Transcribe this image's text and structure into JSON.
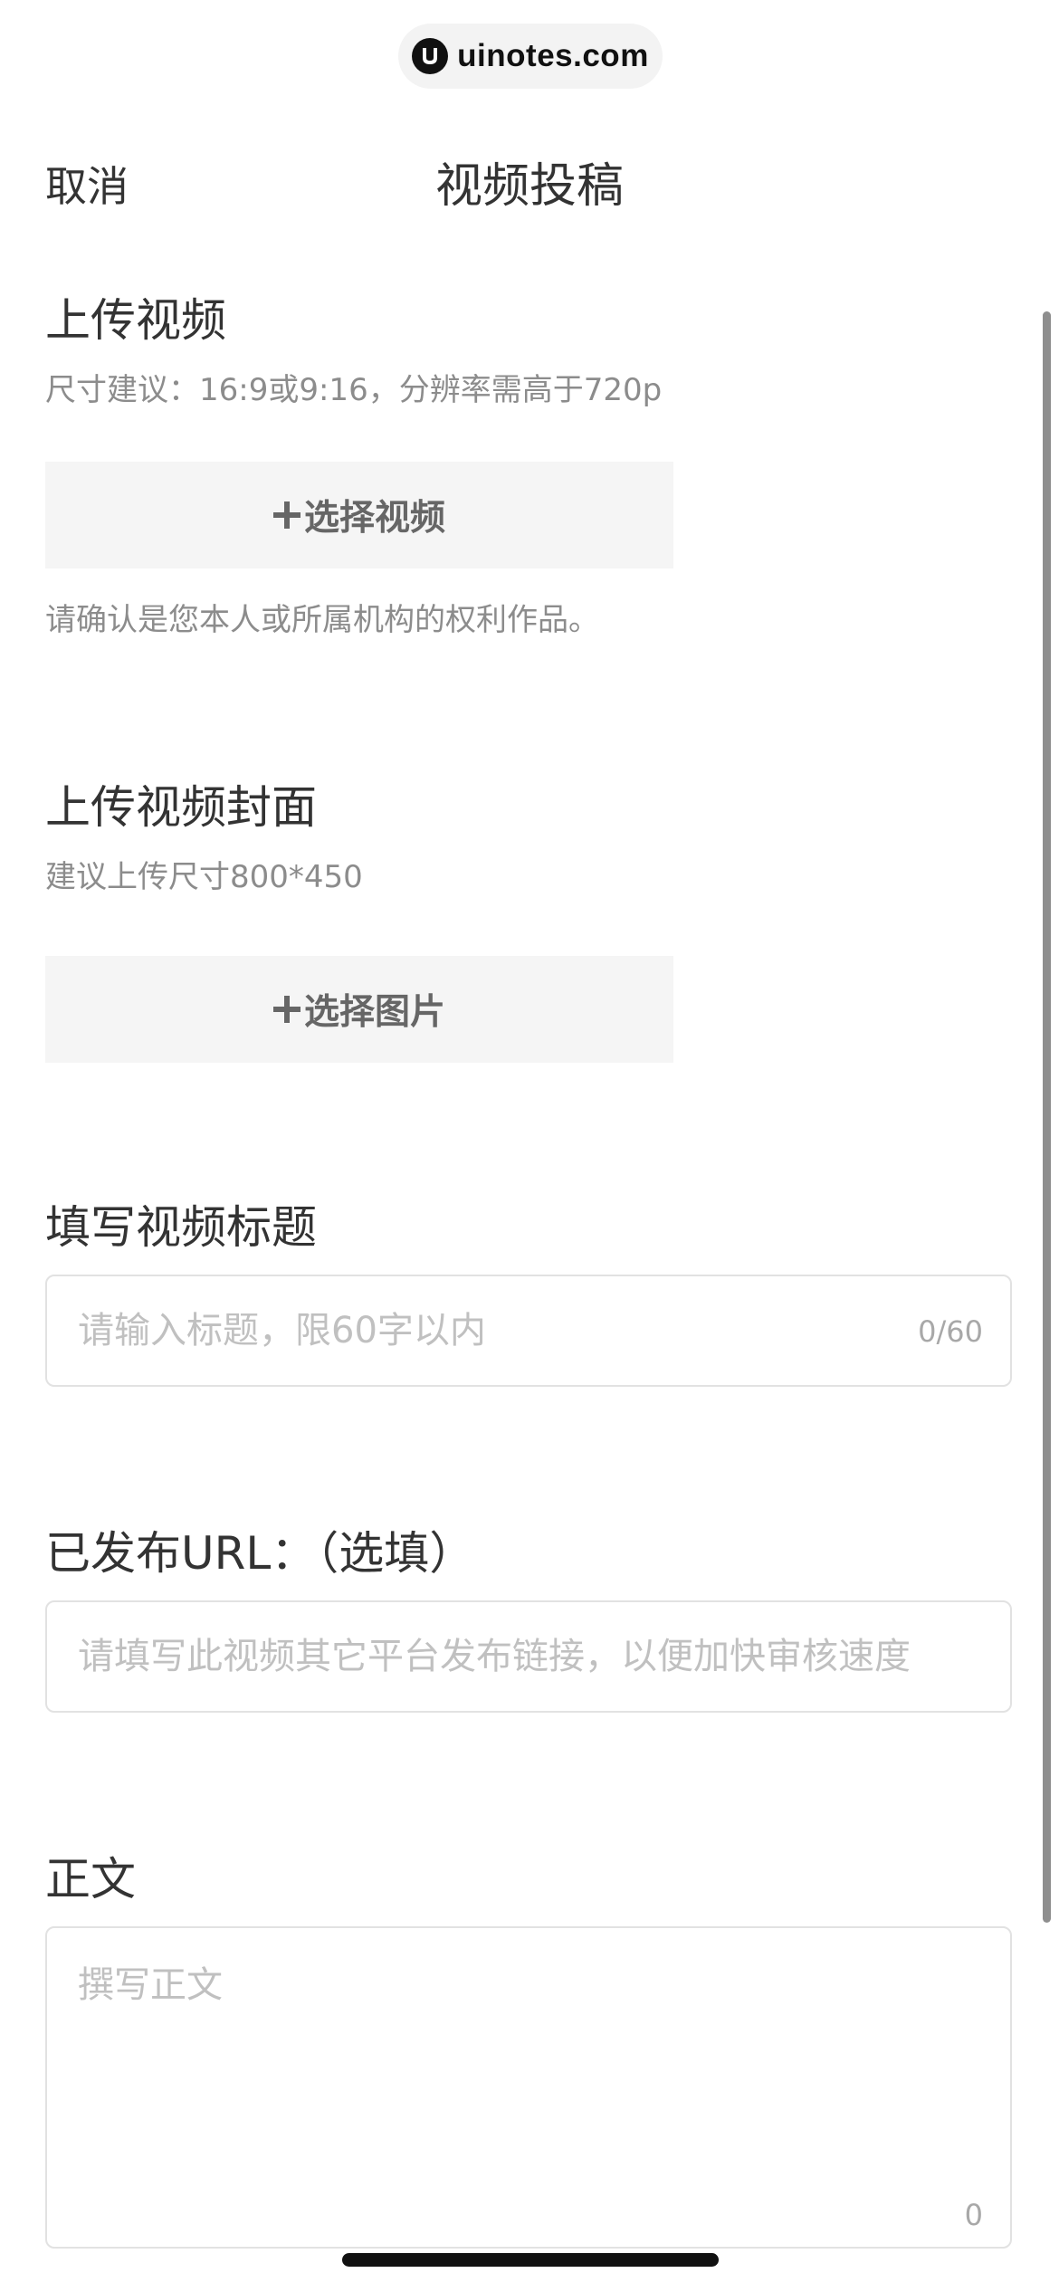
{
  "watermark": {
    "text": "uinotes.com"
  },
  "nav": {
    "cancel_label": "取消",
    "title": "视频投稿"
  },
  "upload_video": {
    "heading": "上传视频",
    "hint": "尺寸建议：16:9或9:16，分辨率需高于720p",
    "button_label": "选择视频",
    "notice": "请确认是您本人或所属机构的权利作品。"
  },
  "upload_cover": {
    "heading": "上传视频封面",
    "hint": "建议上传尺寸800*450",
    "button_label": "选择图片"
  },
  "title_field": {
    "heading": "填写视频标题",
    "placeholder": "请输入标题，限60字以内",
    "value": "",
    "counter": "0/60"
  },
  "url_field": {
    "heading": "已发布URL：（选填）",
    "placeholder": "请填写此视频其它平台发布链接，以便加快审核速度",
    "value": ""
  },
  "body_field": {
    "heading": "正文",
    "placeholder": "撰写正文",
    "value": "",
    "counter": "0"
  },
  "colors": {
    "text_primary": "#333333",
    "text_hint": "#8c8c8c",
    "placeholder": "#c0c0c0",
    "button_bg": "#f5f5f5",
    "field_border": "#e2e2e2"
  }
}
